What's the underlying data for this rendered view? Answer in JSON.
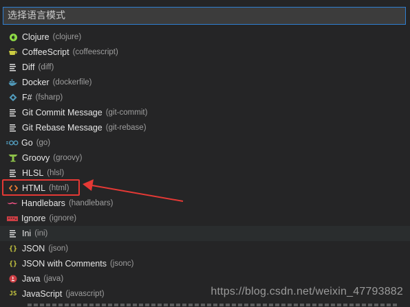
{
  "search": {
    "placeholder": "选择语言模式",
    "value": ""
  },
  "items": [
    {
      "label": "Clojure",
      "id": "(clojure)",
      "icon": "clojure-icon",
      "color": "#91dc47"
    },
    {
      "label": "CoffeeScript",
      "id": "(coffeescript)",
      "icon": "coffee-icon",
      "color": "#cbcb41"
    },
    {
      "label": "Diff",
      "id": "(diff)",
      "icon": "lines-icon",
      "color": "#d4d4d4"
    },
    {
      "label": "Docker",
      "id": "(dockerfile)",
      "icon": "docker-icon",
      "color": "#519aba"
    },
    {
      "label": "F#",
      "id": "(fsharp)",
      "icon": "fsharp-icon",
      "color": "#519aba"
    },
    {
      "label": "Git Commit Message",
      "id": "(git-commit)",
      "icon": "lines-icon",
      "color": "#d4d4d4"
    },
    {
      "label": "Git Rebase Message",
      "id": "(git-rebase)",
      "icon": "lines-icon",
      "color": "#d4d4d4"
    },
    {
      "label": "Go",
      "id": "(go)",
      "icon": "go-icon",
      "color": "#519aba"
    },
    {
      "label": "Groovy",
      "id": "(groovy)",
      "icon": "groovy-icon",
      "color": "#8dc149"
    },
    {
      "label": "HLSL",
      "id": "(hlsl)",
      "icon": "lines-icon",
      "color": "#d4d4d4"
    },
    {
      "label": "HTML",
      "id": "(html)",
      "icon": "html-icon",
      "color": "#e37933"
    },
    {
      "label": "Handlebars",
      "id": "(handlebars)",
      "icon": "handlebars-icon",
      "color": "#f55385"
    },
    {
      "label": "Ignore",
      "id": "(ignore)",
      "icon": "ignore-icon",
      "color": "#cc3e44"
    },
    {
      "label": "Ini",
      "id": "(ini)",
      "icon": "lines-icon",
      "color": "#d4d4d4"
    },
    {
      "label": "JSON",
      "id": "(json)",
      "icon": "braces-icon",
      "color": "#cbcb41"
    },
    {
      "label": "JSON with Comments",
      "id": "(jsonc)",
      "icon": "braces-icon",
      "color": "#cbcb41"
    },
    {
      "label": "Java",
      "id": "(java)",
      "icon": "java-icon",
      "color": "#cc3e44"
    },
    {
      "label": "JavaScript",
      "id": "(javascript)",
      "icon": "js-icon",
      "color": "#cbcb41"
    }
  ],
  "hovered_index": 13,
  "annotation": {
    "box_color": "#e53935",
    "arrow_color": "#e53935"
  },
  "watermark": "https://blog.csdn.net/weixin_47793882"
}
